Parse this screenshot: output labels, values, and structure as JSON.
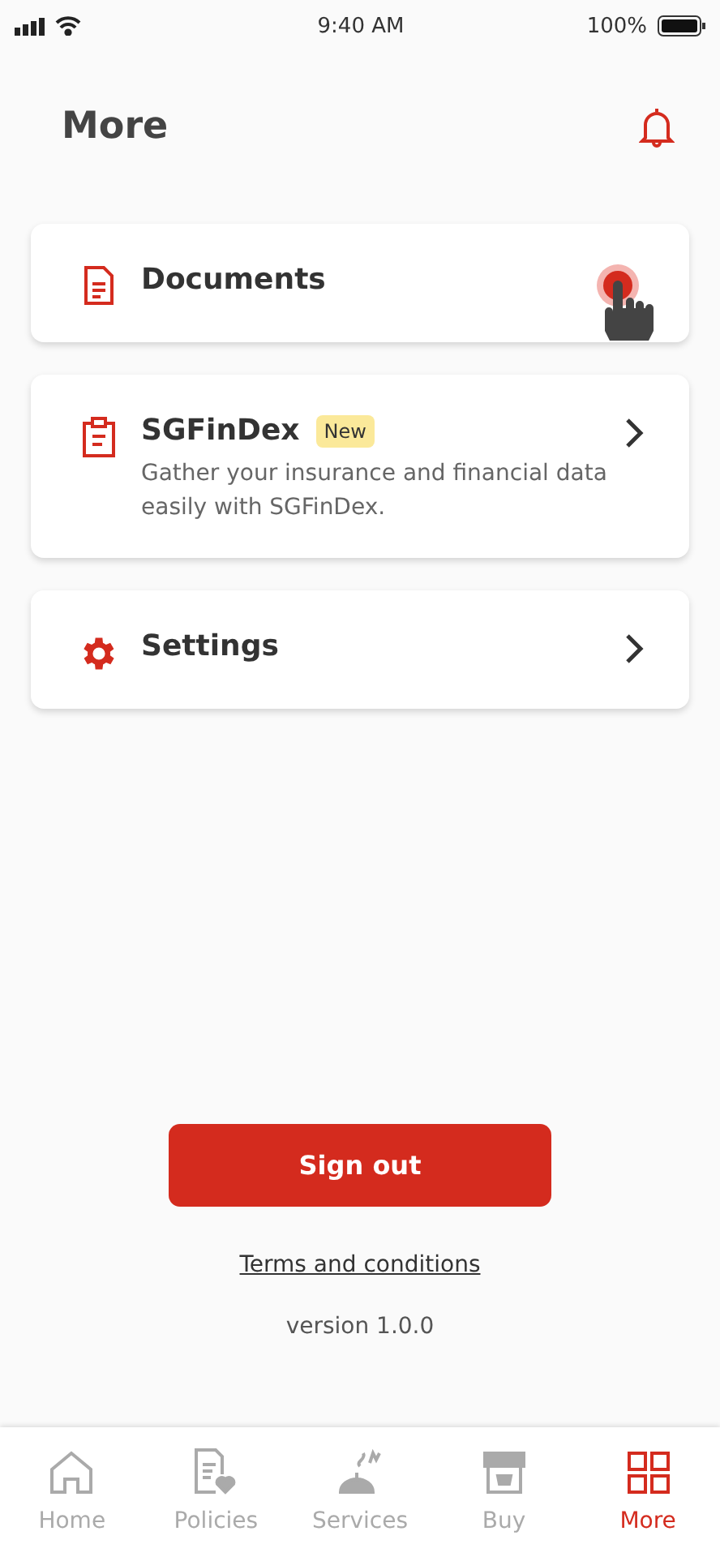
{
  "status_bar": {
    "time": "9:40 AM",
    "battery": "100%"
  },
  "header": {
    "title": "More"
  },
  "cards": [
    {
      "kind": "document",
      "title": "Documents",
      "chevron": false,
      "tapped": true
    },
    {
      "kind": "clipboard",
      "title": "SGFinDex",
      "badge": "New",
      "description": "Gather your insurance and financial data easily with SGFinDex.",
      "chevron": true,
      "tapped": false
    },
    {
      "kind": "gear",
      "title": "Settings",
      "chevron": true,
      "tapped": false
    }
  ],
  "sign_out": "Sign out",
  "terms": "Terms and conditions",
  "version": "version 1.0.0",
  "tabs": [
    {
      "kind": "home",
      "label": "Home",
      "selected": false
    },
    {
      "kind": "policies",
      "label": "Policies",
      "selected": false
    },
    {
      "kind": "services",
      "label": "Services",
      "selected": false
    },
    {
      "kind": "buy",
      "label": "Buy",
      "selected": false
    },
    {
      "kind": "more",
      "label": "More",
      "selected": true
    }
  ]
}
